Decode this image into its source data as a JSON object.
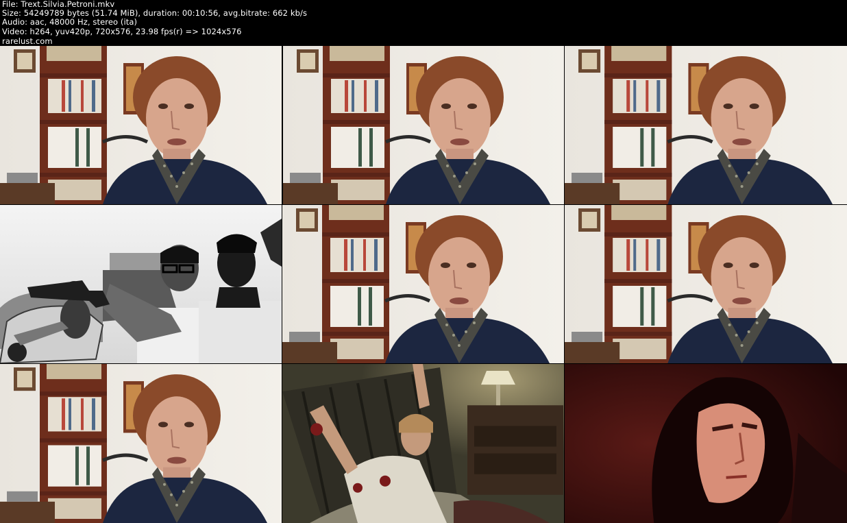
{
  "header": {
    "lines": [
      "File: Trext.Silvia.Petroni.mkv",
      "Size: 54249789 bytes (51.74 MiB), duration: 00:10:56, avg.bitrate: 662 kb/s",
      "Audio: aac, 48000 Hz, stereo (ita)",
      "Video: h264, yuv420p, 720x576, 23.98 fps(r) => 1024x576",
      "rarelust.com"
    ]
  },
  "thumbnails": [
    {
      "scene": "interview-woman",
      "row": 1,
      "col": 1
    },
    {
      "scene": "interview-woman",
      "row": 1,
      "col": 2
    },
    {
      "scene": "interview-woman",
      "row": 1,
      "col": 3
    },
    {
      "scene": "bw-film-still-gun",
      "row": 2,
      "col": 1
    },
    {
      "scene": "interview-woman",
      "row": 2,
      "col": 2
    },
    {
      "scene": "interview-woman",
      "row": 2,
      "col": 3
    },
    {
      "scene": "interview-woman",
      "row": 3,
      "col": 1
    },
    {
      "scene": "film-still-bed-woman",
      "row": 3,
      "col": 2
    },
    {
      "scene": "film-still-hooded-man",
      "row": 3,
      "col": 3
    }
  ],
  "colors": {
    "background": "#000000",
    "text": "#ffffff",
    "wall": "#ece8e1",
    "bookshelf": "#6e2e1c",
    "sweater": "#1c2640",
    "hair": "#8a4a2a",
    "skin": "#d7a58c"
  }
}
